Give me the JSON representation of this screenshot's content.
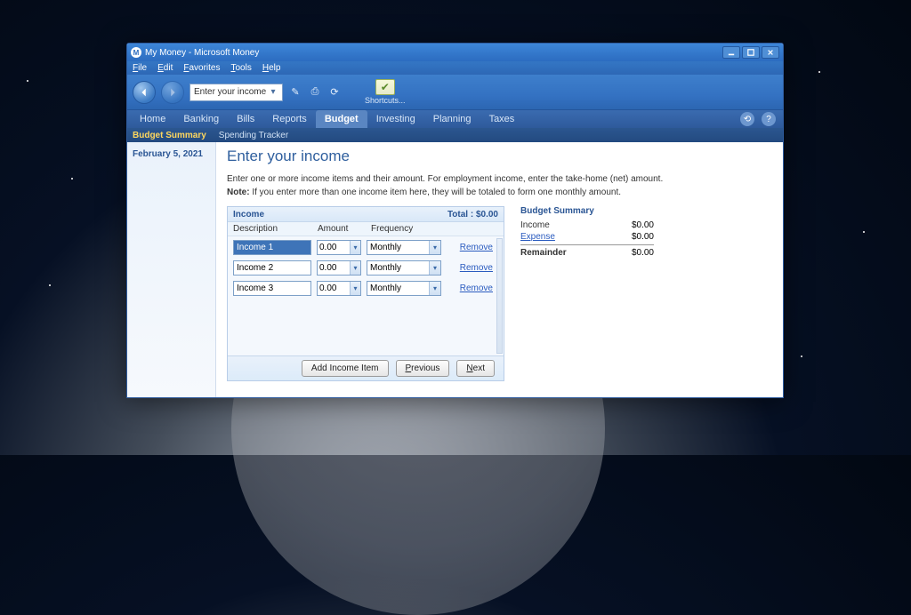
{
  "window": {
    "title": "My Money - Microsoft Money"
  },
  "menu": {
    "file": "File",
    "edit": "Edit",
    "favorites": "Favorites",
    "tools": "Tools",
    "help": "Help"
  },
  "toolbar": {
    "address": "Enter your income",
    "shortcuts": "Shortcuts..."
  },
  "tabs": {
    "home": "Home",
    "banking": "Banking",
    "bills": "Bills",
    "reports": "Reports",
    "budget": "Budget",
    "investing": "Investing",
    "planning": "Planning",
    "taxes": "Taxes"
  },
  "subtabs": {
    "summary": "Budget Summary",
    "tracker": "Spending Tracker"
  },
  "sidebar": {
    "date": "February 5, 2021"
  },
  "page": {
    "heading": "Enter your income",
    "intro": "Enter one or more income items and their amount. For employment income, enter the take-home (net) amount.",
    "note_label": "Note:",
    "note_text": " If you enter more than one income item here, they will be totaled to form one monthly amount."
  },
  "panel": {
    "title": "Income",
    "total_label": "Total : $0.00",
    "col_desc": "Description",
    "col_amount": "Amount",
    "col_freq": "Frequency",
    "rows": [
      {
        "desc": "Income 1",
        "amount": "0.00",
        "freq": "Monthly",
        "remove": "Remove",
        "selected": true
      },
      {
        "desc": "Income 2",
        "amount": "0.00",
        "freq": "Monthly",
        "remove": "Remove",
        "selected": false
      },
      {
        "desc": "Income 3",
        "amount": "0.00",
        "freq": "Monthly",
        "remove": "Remove",
        "selected": false
      }
    ],
    "add_btn": "Add Income Item",
    "prev_btn": "Previous",
    "next_btn": "Next"
  },
  "summary": {
    "heading": "Budget Summary",
    "income_label": "Income",
    "income_val": "$0.00",
    "expense_label": "Expense",
    "expense_val": "$0.00",
    "remainder_label": "Remainder",
    "remainder_val": "$0.00"
  }
}
